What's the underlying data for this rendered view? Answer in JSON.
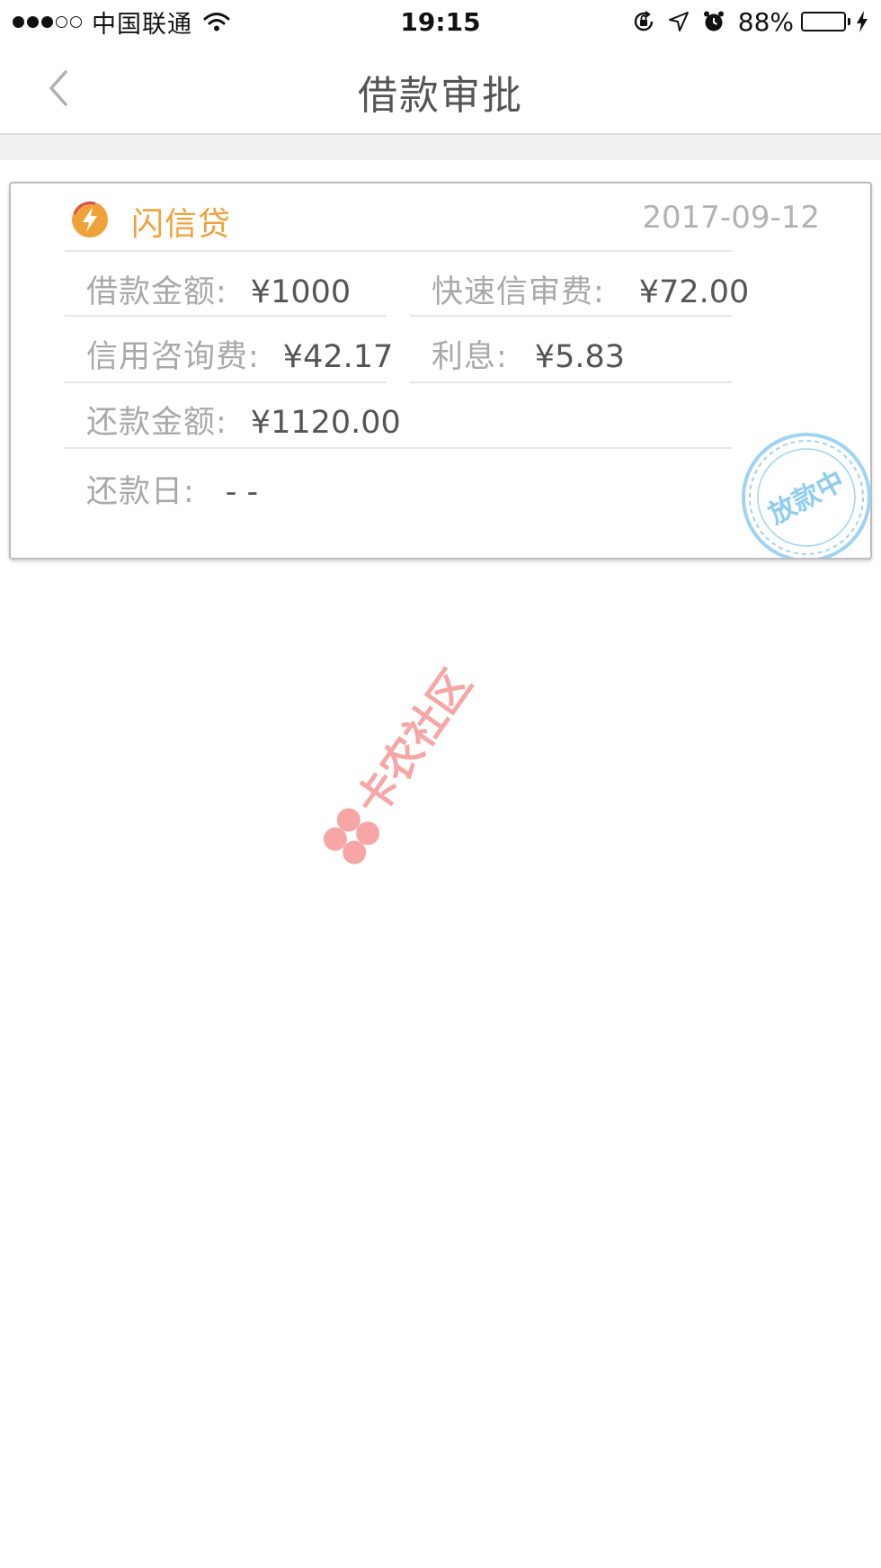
{
  "status_bar": {
    "carrier": "中国联通",
    "signal_bars_filled": 3,
    "signal_bars_total": 5,
    "time": "19:15",
    "battery_percent": "88%",
    "battery_level": 0.88,
    "battery_color": "#4cd964",
    "icons": [
      "wifi-icon",
      "rotation-lock-icon",
      "location-arrow-icon",
      "alarm-icon",
      "battery-icon",
      "charging-bolt-icon"
    ]
  },
  "nav": {
    "title": "借款审批",
    "back_icon": "chevron-left-icon"
  },
  "loan_card": {
    "product_name": "闪信贷",
    "product_icon": "lightning-bolt-icon",
    "date": "2017-09-12",
    "accent_color": "#f0a23a",
    "fields": {
      "loan_amount": {
        "label": "借款金额:",
        "value": "¥1000"
      },
      "fast_credit_fee": {
        "label": "快速信审费:",
        "value": "¥72.00"
      },
      "credit_consult_fee": {
        "label": "信用咨询费:",
        "value": "¥42.17"
      },
      "interest": {
        "label": "利息:",
        "value": "¥5.83"
      },
      "repay_amount": {
        "label": "还款金额:",
        "value": "¥1120.00"
      },
      "repay_date": {
        "label": "还款日:",
        "value": "- -"
      }
    },
    "stamp_text": "放款中",
    "stamp_color": "#8ecdf0"
  },
  "watermark": {
    "text": "卡农社区",
    "color": "#f7a6a6"
  }
}
